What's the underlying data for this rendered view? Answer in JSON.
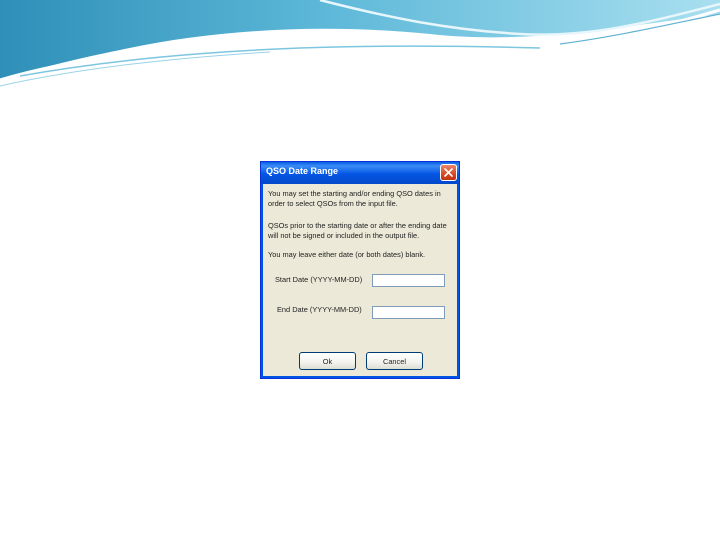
{
  "dialog": {
    "title": "QSO Date Range",
    "paragraphs": [
      "You may set the starting and/or ending QSO dates in order to select QSOs from the input file.",
      "QSOs prior to the starting date or after the ending date will not be signed or included in the output file.",
      "You may leave either date (or both dates) blank."
    ],
    "start_label": "Start Date (YYYY-MM-DD)",
    "end_label": "End Date (YYYY-MM-DD)",
    "start_value": "",
    "end_value": "",
    "ok_label": "Ok",
    "cancel_label": "Cancel"
  },
  "icons": {
    "close": "close-icon"
  },
  "colors": {
    "titlebar": "#0456e4",
    "dialog_bg": "#ece9d8",
    "close_button": "#d64a24"
  }
}
